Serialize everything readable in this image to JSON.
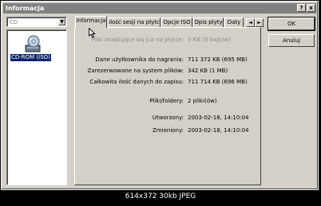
{
  "window": {
    "title": "Informacja",
    "help_label": "?",
    "close_label": "x"
  },
  "left": {
    "combo_value": "CD",
    "combo_arrow": "▼",
    "items": [
      {
        "label": "CD-ROM (ISO)",
        "icon": "cd-drive-icon"
      }
    ]
  },
  "tabs": [
    {
      "label": "Informacja"
    },
    {
      "label": "Ilość sesji na płytce"
    },
    {
      "label": "Opcje ISO"
    },
    {
      "label": "Opis płyty"
    },
    {
      "label": "Daty"
    }
  ],
  "tab_scroll": {
    "left": "◄",
    "right": "►"
  },
  "info": {
    "free_space": {
      "label": "Pliki znajdujące się już na płytce:",
      "value": "0 KB (0 bajtów)"
    },
    "user_data": {
      "label": "Dane użytkownika do nagrania:",
      "value": "711 372 KB (695 MB)"
    },
    "reserved": {
      "label": "Zarezerwowane na system plików:",
      "value": "342 KB (1 MB)"
    },
    "total": {
      "label": "Całkowita ilość danych do zapisu:",
      "value": "711 714 KB (696 MB)"
    },
    "files": {
      "label": "Pliki/foldery:",
      "value": "2 pliki(ów)"
    },
    "created": {
      "label": "Utworzony:",
      "value": "2003-02-18, 14:10:04"
    },
    "modified": {
      "label": "Zmieniony:",
      "value": "2003-02-18, 14:10:04"
    }
  },
  "buttons": {
    "ok": "OK",
    "cancel": "Anuluj"
  },
  "caption": "614x372 30kb JPEG"
}
